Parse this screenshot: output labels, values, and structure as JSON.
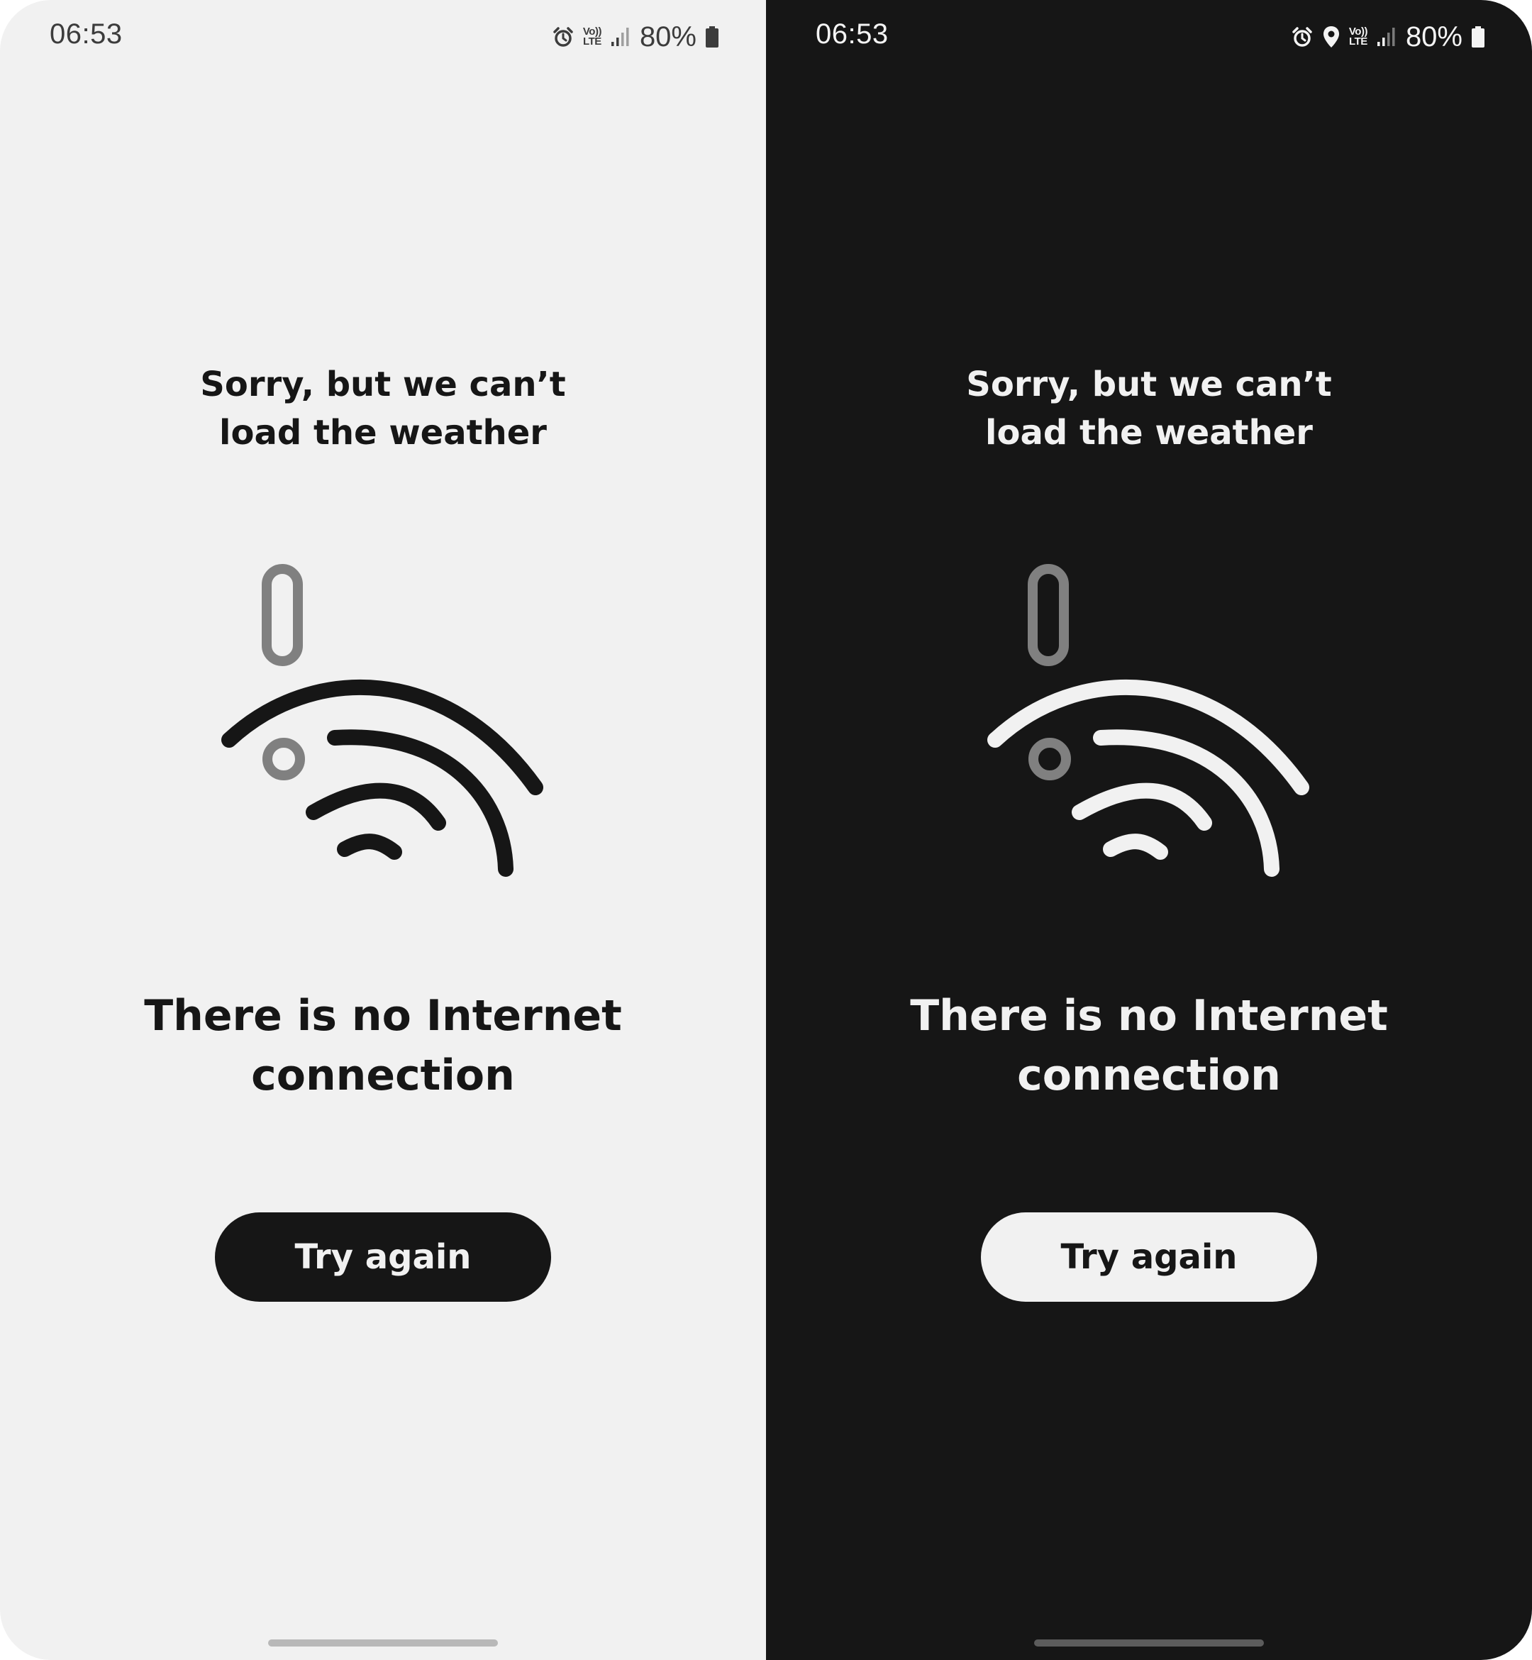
{
  "screens": [
    {
      "theme": "light",
      "status_bar": {
        "time": "06:53",
        "icons": [
          "alarm-icon",
          "volte-lte-icon",
          "signal-icon",
          "battery-icon"
        ],
        "volte_top": "Vo))",
        "volte_bottom": "LTE",
        "battery": "80%"
      },
      "message": [
        "Sorry, but we can’t",
        "load the weather"
      ],
      "headline": [
        "There is no Internet",
        "connection"
      ],
      "button_label": "Try again",
      "colors": {
        "background": "#f1f1f1",
        "foreground": "#161616",
        "accent_gray": "#808080"
      }
    },
    {
      "theme": "dark",
      "status_bar": {
        "time": "06:53",
        "icons": [
          "alarm-icon",
          "location-pin-icon",
          "volte-lte-icon",
          "signal-icon",
          "battery-icon"
        ],
        "volte_top": "Vo))",
        "volte_bottom": "LTE",
        "battery": "80%"
      },
      "message": [
        "Sorry, but we can’t",
        "load the weather"
      ],
      "headline": [
        "There is no Internet",
        "connection"
      ],
      "button_label": "Try again",
      "colors": {
        "background": "#161616",
        "foreground": "#f1f1f1",
        "accent_gray": "#808080"
      }
    }
  ],
  "illustration_icon": "broken-wifi-icon"
}
